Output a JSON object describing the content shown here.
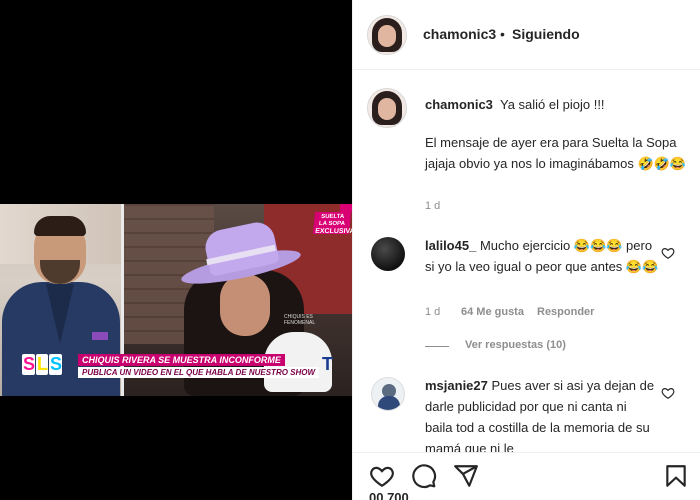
{
  "post": {
    "username": "chamonic3",
    "separator": "•",
    "follow_status": "Siguiendo",
    "caption_first_line": "Ya salió el piojo !!!",
    "caption_body": "El mensaje de ayer era para Suelta la Sopa jajaja obvio ya nos lo imaginábamos 🤣🤣😂",
    "caption_time": "1 d"
  },
  "video_overlay": {
    "badge_lines": [
      "SUELTA",
      "LA SOPA",
      "EXCLUSIVA"
    ],
    "logo_letters": [
      "S",
      "L",
      "S"
    ],
    "headline": "CHIQUIS RIVERA SE MUESTRA INCONFORME",
    "subheadline": "PUBLICA UN VIDEO EN EL QUE HABLA DE NUESTRO SHOW",
    "small_caption": "CHIQUIS ES FENOMENAL",
    "mic_logo": "T"
  },
  "comments": [
    {
      "username": "lalilo45_",
      "text": "Mucho ejercicio 😂😂😂 pero si yo la veo igual o peor que antes 😂😂",
      "time": "1 d",
      "likes": "64 Me gusta",
      "reply_label": "Responder",
      "view_replies": "Ver respuestas (10)"
    },
    {
      "username": "msjanie27",
      "text": "Pues aver si asi ya dejan de darle publicidad por que ni canta ni baila tod a costilla de la memoria de su mamá que ni le"
    }
  ],
  "footer": {
    "likes_partial": "00,700 ..."
  },
  "icons": {
    "like": "heart-icon",
    "comment": "comment-icon",
    "share": "share-icon",
    "save": "bookmark-icon"
  }
}
